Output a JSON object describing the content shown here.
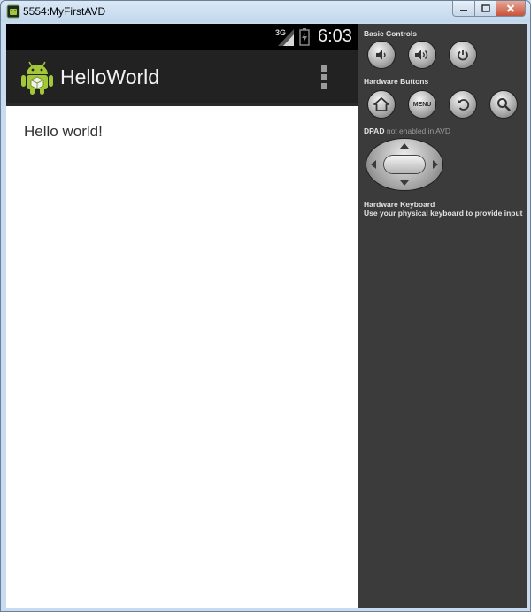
{
  "window": {
    "title": "5554:MyFirstAVD"
  },
  "status_bar": {
    "network": "3G",
    "time": "6:03"
  },
  "action_bar": {
    "app_title": "HelloWorld"
  },
  "main": {
    "text": "Hello world!"
  },
  "panel": {
    "basic_controls_title": "Basic Controls",
    "hardware_buttons_title": "Hardware Buttons",
    "menu_label": "MENU",
    "dpad_title": "DPAD",
    "dpad_note": "not enabled in AVD",
    "keyboard_title": "Hardware Keyboard",
    "keyboard_note": "Use your physical keyboard to provide input"
  }
}
